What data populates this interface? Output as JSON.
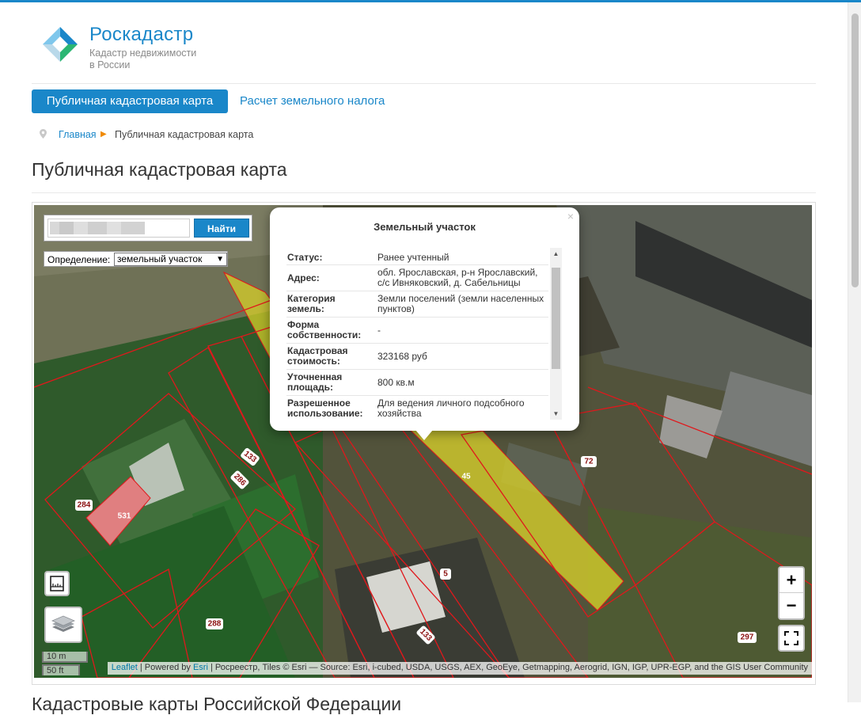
{
  "brand": {
    "title": "Роскадастр",
    "subtitle_line1": "Кадастр недвижимости",
    "subtitle_line2": "в России"
  },
  "nav": {
    "active": "Публичная кадастровая карта",
    "link": "Расчет земельного налога"
  },
  "breadcrumb": {
    "home": "Главная",
    "current": "Публичная кадастровая карта"
  },
  "page_title": "Публичная кадастровая карта",
  "section_title": "Кадастровые карты Российской Федерации",
  "search": {
    "button": "Найти",
    "definition_label": "Определение:",
    "definition_value": "земельный участок"
  },
  "popup": {
    "title": "Земельный участок",
    "close": "×",
    "rows": [
      {
        "key": "Статус:",
        "value": "Ранее учтенный"
      },
      {
        "key": "Адрес:",
        "value": "обл. Ярославская, р-н Ярославский, с/с Ивняковский, д. Сабельницы"
      },
      {
        "key": "Категория земель:",
        "value": "Земли поселений (земли населенных пунктов)"
      },
      {
        "key": "Форма собственности:",
        "value": "-"
      },
      {
        "key": "Кадастровая стоимость:",
        "value": "323168 руб"
      },
      {
        "key": "Уточненная площадь:",
        "value": "800 кв.м"
      },
      {
        "key": "Разрешенное использование:",
        "value": "Для ведения личного подсобного хозяйства"
      }
    ]
  },
  "parcel_labels": [
    "133",
    "286",
    "284",
    "531",
    "288",
    "45",
    "72",
    "5",
    "133",
    "297"
  ],
  "zoom": {
    "in": "+",
    "out": "−"
  },
  "scale": {
    "metric": "10 m",
    "imperial": "50 ft"
  },
  "attribution": {
    "leaflet": "Leaflet",
    "powered": " | Powered by ",
    "esri": "Esri",
    "rest": " | Росреестр, Tiles © Esri — Source: Esri, i-cubed, USDA, USGS, AEX, GeoEye, Getmapping, Aerogrid, IGN, IGP, UPR-EGP, and the GIS User Community"
  },
  "colors": {
    "accent": "#1a87c9",
    "parcel_selected": "#d7cf2a",
    "parcel_border": "#e0181c",
    "building": "#e07f80"
  }
}
